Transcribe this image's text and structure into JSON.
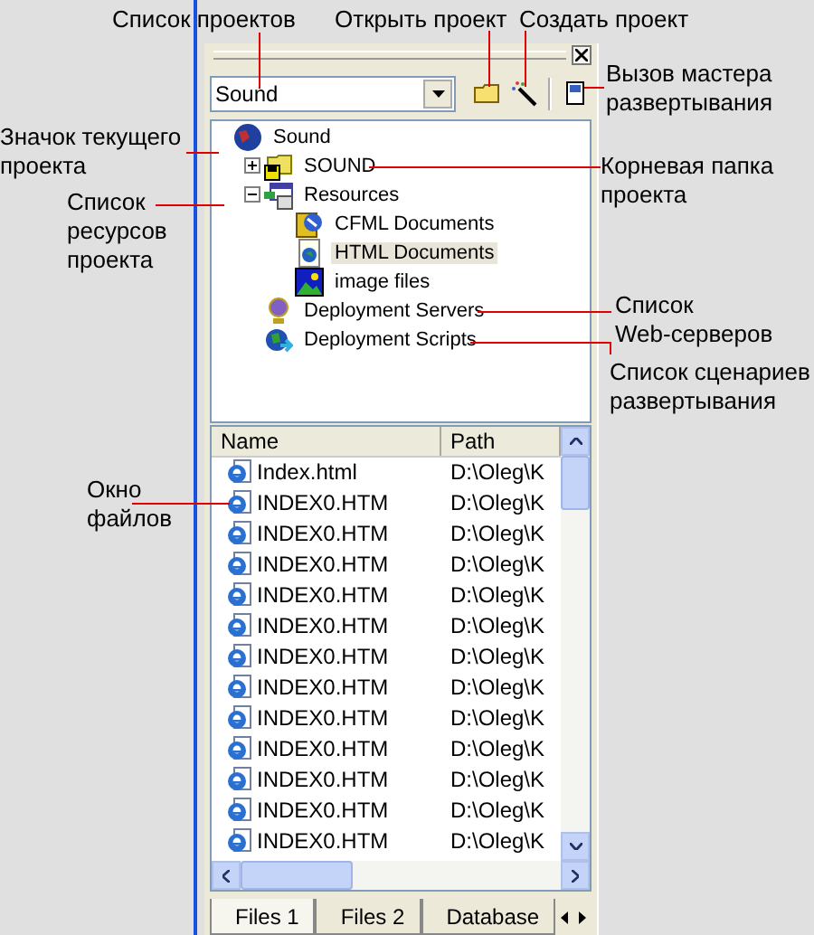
{
  "annotations": [
    {
      "text": "Список проектов"
    },
    {
      "text": "Открыть проект"
    },
    {
      "text": "Создать проект"
    },
    {
      "text": "Вызов мастера\nразвертывания"
    },
    {
      "text": "Значок текущего\nпроекта"
    },
    {
      "text": "Корневая папка\nпроекта"
    },
    {
      "text": "Список\nресурсов\nпроекта"
    },
    {
      "text": "Список\nWeb-серверов"
    },
    {
      "text": "Список сценариев\nразвертывания"
    },
    {
      "text": "Окно\nфайлов"
    }
  ],
  "panel": {
    "project_combo": {
      "value": "Sound"
    },
    "tree": [
      {
        "label": "Sound",
        "kind": "project",
        "selected": false,
        "children": [
          {
            "label": "SOUND",
            "kind": "folder",
            "selected": false,
            "expanded": false
          },
          {
            "label": "Resources",
            "kind": "resources",
            "selected": false,
            "expanded": true,
            "children": [
              {
                "label": "CFML Documents",
                "kind": "cfml",
                "selected": false
              },
              {
                "label": "HTML Documents",
                "kind": "html",
                "selected": true
              },
              {
                "label": "image files",
                "kind": "image",
                "selected": false
              }
            ]
          },
          {
            "label": "Deployment Servers",
            "kind": "servers",
            "selected": false
          },
          {
            "label": "Deployment Scripts",
            "kind": "scripts",
            "selected": false
          }
        ]
      }
    ],
    "file_list": {
      "columns": [
        "Name",
        "Path"
      ],
      "rows": [
        {
          "name": "Index.html",
          "path": "D:\\Oleg\\K"
        },
        {
          "name": "INDEX0.HTM",
          "path": "D:\\Oleg\\K"
        },
        {
          "name": "INDEX0.HTM",
          "path": "D:\\Oleg\\K"
        },
        {
          "name": "INDEX0.HTM",
          "path": "D:\\Oleg\\K"
        },
        {
          "name": "INDEX0.HTM",
          "path": "D:\\Oleg\\K"
        },
        {
          "name": "INDEX0.HTM",
          "path": "D:\\Oleg\\K"
        },
        {
          "name": "INDEX0.HTM",
          "path": "D:\\Oleg\\K"
        },
        {
          "name": "INDEX0.HTM",
          "path": "D:\\Oleg\\K"
        },
        {
          "name": "INDEX0.HTM",
          "path": "D:\\Oleg\\K"
        },
        {
          "name": "INDEX0.HTM",
          "path": "D:\\Oleg\\K"
        },
        {
          "name": "INDEX0.HTM",
          "path": "D:\\Oleg\\K"
        },
        {
          "name": "INDEX0.HTM",
          "path": "D:\\Oleg\\K"
        },
        {
          "name": "INDEX0.HTM",
          "path": "D:\\Oleg\\K"
        }
      ]
    },
    "tabs": [
      {
        "label": "Files 1",
        "selected": true
      },
      {
        "label": "Files 2",
        "selected": false
      },
      {
        "label": "Database",
        "selected": false
      }
    ]
  }
}
